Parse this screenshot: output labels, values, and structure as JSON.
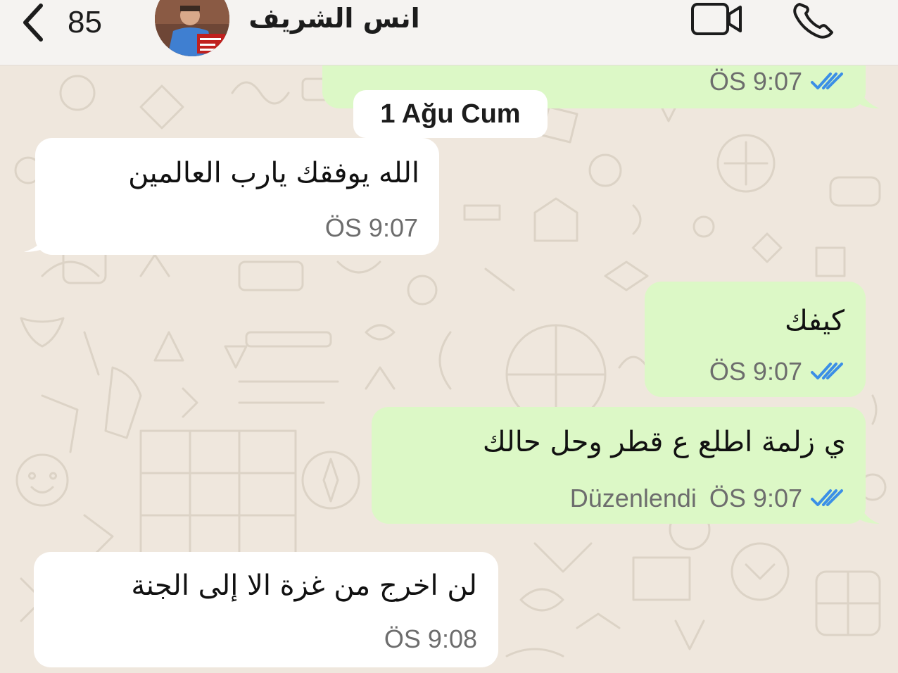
{
  "header": {
    "unread_count": "85",
    "contact_name": "انس الشريف",
    "back_icon": "chevron-left-icon",
    "video_icon": "video-camera-icon",
    "call_icon": "phone-icon"
  },
  "colors": {
    "outgoing_bubble": "#dcf8c6",
    "incoming_bubble": "#ffffff",
    "chat_background": "#efe7dd",
    "read_ticks": "#3b8fe6"
  },
  "date_separator": "1 Ağu Cum",
  "messages": [
    {
      "direction": "out",
      "text": "",
      "time": "ÖS 9:07",
      "edited": "",
      "status": "read"
    },
    {
      "direction": "in",
      "text": "الله يوفقك يارب العالمين",
      "time": "ÖS 9:07",
      "edited": ""
    },
    {
      "direction": "out",
      "text": "كيفك",
      "time": "ÖS 9:07",
      "edited": "",
      "status": "read"
    },
    {
      "direction": "out",
      "text": "ي زلمة اطلع ع قطر وحل حالك",
      "time": "ÖS 9:07",
      "edited": "Düzenlendi",
      "status": "read"
    },
    {
      "direction": "in",
      "text": "لن اخرج من غزة الا إلى الجنة",
      "time": "ÖS 9:08",
      "edited": ""
    }
  ]
}
